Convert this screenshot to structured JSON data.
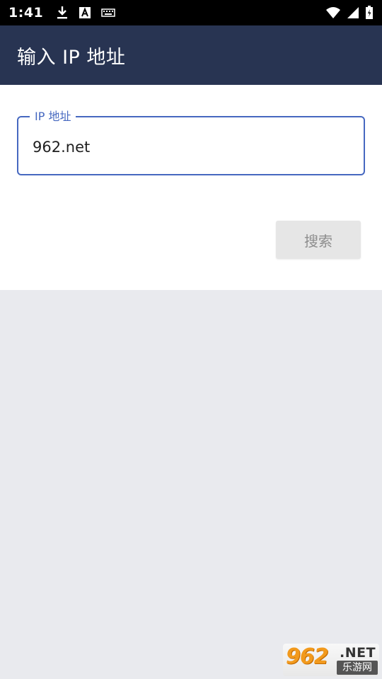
{
  "status_bar": {
    "time": "1:41",
    "left_icons": [
      "download-icon",
      "text-a-icon",
      "keyboard-icon"
    ],
    "right_icons": [
      "wifi-icon",
      "signal-icon",
      "battery-icon"
    ]
  },
  "app_bar": {
    "title": "输入 IP 地址",
    "background": "#283452"
  },
  "form": {
    "ip_field": {
      "label": "IP 地址",
      "value": "962.net",
      "accent": "#4668c0"
    },
    "search_button": {
      "label": "搜索"
    }
  },
  "watermark": {
    "number": "962",
    "suffix": ".NET",
    "chinese": "乐游网"
  }
}
